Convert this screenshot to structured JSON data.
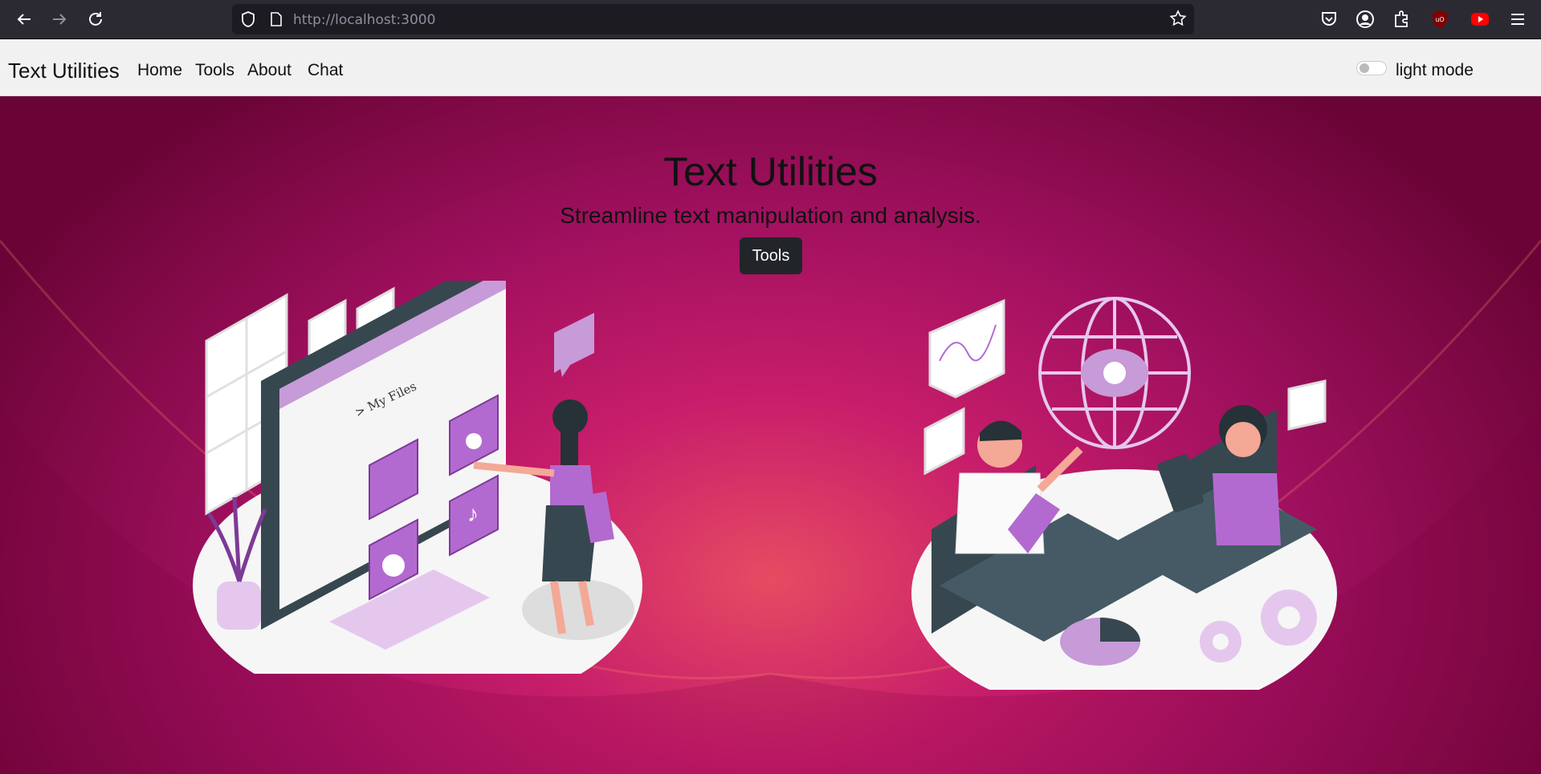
{
  "browser": {
    "url_scheme": "http://",
    "url_host": "localhost",
    "url_port": ":3000",
    "icons": [
      "back-icon",
      "forward-icon",
      "reload-icon",
      "shield-icon",
      "page-icon",
      "bookmark-star-icon",
      "pocket-icon",
      "account-icon",
      "extensions-icon",
      "ublock-icon",
      "youtube-icon",
      "menu-icon"
    ]
  },
  "navbar": {
    "brand": "Text Utilities",
    "links": [
      "Home",
      "Tools",
      "About",
      "Chat"
    ],
    "mode_label": "light mode"
  },
  "hero": {
    "title": "Text Utilities",
    "subtitle": "Streamline text manipulation and analysis.",
    "button_label": "Tools",
    "illustration_left_label": "> My Files"
  },
  "colors": {
    "accent_purple": "#b36ad0",
    "hero_center": "#e64b62",
    "hero_edge": "#6a0436",
    "button_bg": "#212529"
  }
}
